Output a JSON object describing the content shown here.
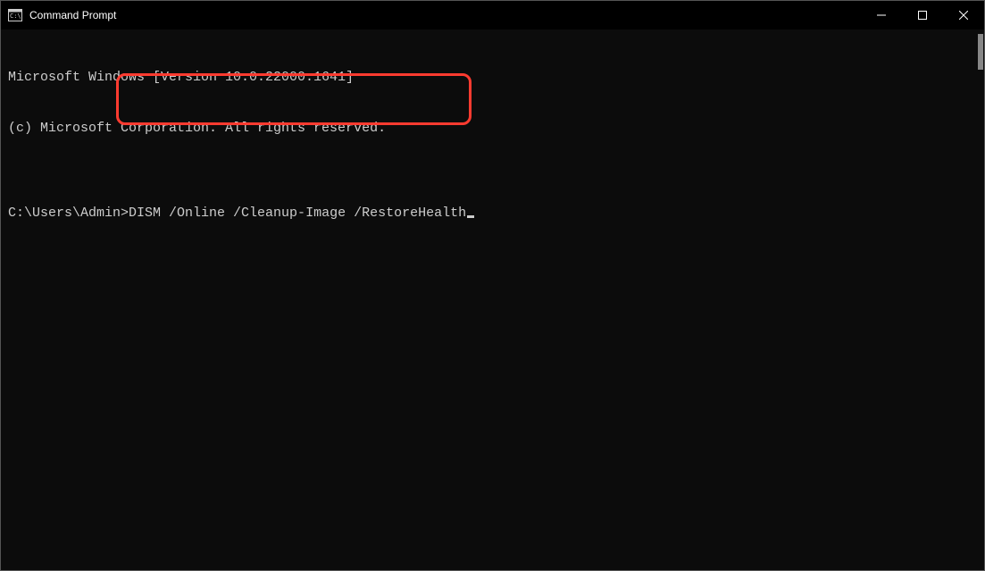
{
  "window": {
    "title": "Command Prompt"
  },
  "terminal": {
    "line1": "Microsoft Windows [Version 10.0.22000.1641]",
    "line2": "(c) Microsoft Corporation. All rights reserved.",
    "blank": "",
    "prompt": "C:\\Users\\Admin>",
    "command": "DISM /Online /Cleanup-Image /RestoreHealth"
  }
}
